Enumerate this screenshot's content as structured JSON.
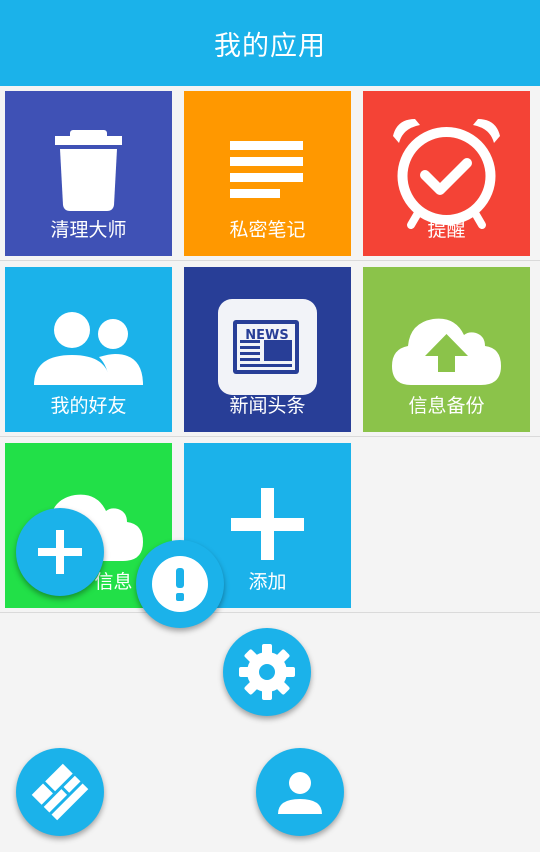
{
  "header": {
    "title": "我的应用"
  },
  "tiles": [
    {
      "label": "清理大师",
      "icon": "trash-icon",
      "color": "#3f51b5"
    },
    {
      "label": "私密笔记",
      "icon": "notes-lines-icon",
      "color": "#ff9800"
    },
    {
      "label": "提醒",
      "icon": "alarm-clock-icon",
      "color": "#f44336"
    },
    {
      "label": "我的好友",
      "icon": "friends-icon",
      "color": "#1bb2ea"
    },
    {
      "label": "新闻头条",
      "icon": "news-icon",
      "color": "#283e97"
    },
    {
      "label": "信息备份",
      "icon": "cloud-upload-icon",
      "color": "#8bc34a"
    },
    {
      "label": "信息",
      "icon": "cloud-icon",
      "color": "#22e048"
    },
    {
      "label": "添加",
      "icon": "plus-icon",
      "color": "#1bb2ea"
    }
  ],
  "fabs": [
    {
      "name": "add-fab",
      "icon": "plus-icon"
    },
    {
      "name": "alert-fab",
      "icon": "exclamation-icon"
    },
    {
      "name": "settings-fab",
      "icon": "gear-icon"
    },
    {
      "name": "menu-fab",
      "icon": "grid-tiles-icon"
    },
    {
      "name": "profile-fab",
      "icon": "person-icon"
    }
  ],
  "news_badge_text": "NEWS",
  "accent_color": "#1bb2ea"
}
